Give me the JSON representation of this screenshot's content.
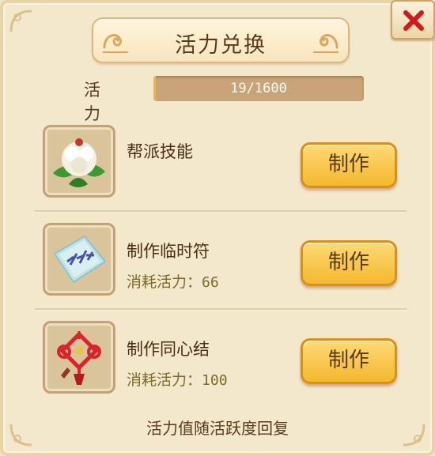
{
  "window": {
    "title": "活力兑换",
    "close_icon": "close-x-icon"
  },
  "energy": {
    "label": "活 力",
    "value_text": "19/1600",
    "current": 19,
    "max": 1600
  },
  "items": [
    {
      "name": "帮派技能",
      "cost_label": "",
      "cost_value": "",
      "icon": "white-flower-icon",
      "button_label": "制作"
    },
    {
      "name": "制作临时符",
      "cost_label": "消耗活力：",
      "cost_value": "66",
      "icon": "talisman-paper-icon",
      "button_label": "制作"
    },
    {
      "name": "制作同心结",
      "cost_label": "消耗活力：",
      "cost_value": "100",
      "icon": "chinese-knot-icon",
      "button_label": "制作"
    }
  ],
  "footer": {
    "hint": "活力值随活跃度回复"
  },
  "colors": {
    "panel_bg": "#f3e8cc",
    "button_gold": "#f4b82e",
    "close_red": "#d11a1a",
    "text_brown": "#5a3a1c"
  }
}
